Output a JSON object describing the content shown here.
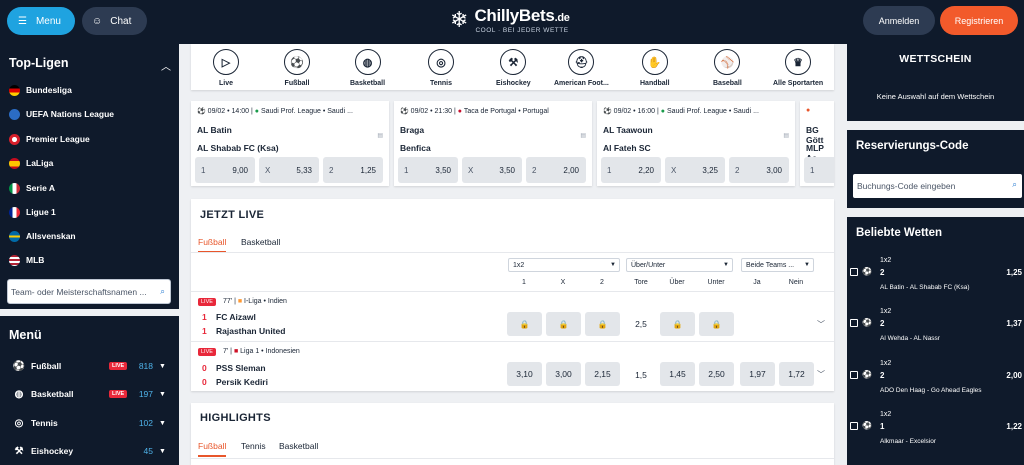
{
  "header": {
    "menu_label": "Menu",
    "chat_label": "Chat",
    "logo_main": "ChillyBets",
    "logo_suffix": ".de",
    "tagline": "COOL · BEI JEDER WETTE",
    "login": "Anmelden",
    "register": "Registrieren"
  },
  "sidebar": {
    "leagues_title": "Top-Ligen",
    "leagues": [
      {
        "name": "Bundesliga",
        "color": "#f3c000"
      },
      {
        "name": "UEFA Nations League",
        "color": "#2b6cc4"
      },
      {
        "name": "Premier League",
        "color": "#d71f2b"
      },
      {
        "name": "LaLiga",
        "color": "#e7a900"
      },
      {
        "name": "Serie A",
        "color": "#1a9b4b"
      },
      {
        "name": "Ligue 1",
        "color": "#1f3c99"
      },
      {
        "name": "Allsvenskan",
        "color": "#2b6cc4"
      },
      {
        "name": "MLB",
        "color": "#cf2233"
      }
    ],
    "search_placeholder": "Team- oder Meisterschaftsnamen ...",
    "menu_title": "Menü",
    "menu_items": [
      {
        "label": "Fußball",
        "live": "LIVE",
        "count": "818"
      },
      {
        "label": "Basketball",
        "live": "LIVE",
        "count": "197"
      },
      {
        "label": "Tennis",
        "live": "",
        "count": "102"
      },
      {
        "label": "Eishockey",
        "live": "",
        "count": "45"
      }
    ]
  },
  "sports": [
    "Live",
    "Fußball",
    "Basketball",
    "Tennis",
    "Eishockey",
    "American Foot...",
    "Handball",
    "Baseball",
    "Alle Sportarten"
  ],
  "events": [
    {
      "date": "09/02 • 14:00",
      "league": "Saudi Prof. League • Saudi ...",
      "home": "AL Batin",
      "away": "AL Shabab FC (Ksa)",
      "odds": [
        "9,00",
        "5,33",
        "1,25"
      ]
    },
    {
      "date": "09/02 • 21:30",
      "league": "Taca de Portugal • Portugal",
      "home": "Braga",
      "away": "Benfica",
      "odds": [
        "3,50",
        "3,50",
        "2,00"
      ]
    },
    {
      "date": "09/02 • 16:00",
      "league": "Saudi Prof. League • Saudi ...",
      "home": "AL Taawoun",
      "away": "Al Fateh SC",
      "odds": [
        "2,20",
        "3,25",
        "3,00"
      ]
    },
    {
      "date": "",
      "league": "",
      "home": "BG Gött",
      "away": "MLP Ac",
      "odds": [
        "1"
      ]
    }
  ],
  "odd_keys": [
    "1",
    "X",
    "2"
  ],
  "live": {
    "title": "JETZT LIVE",
    "tabs": [
      "Fußball",
      "Basketball"
    ],
    "selects": [
      "1x2",
      "Über/Unter",
      "Beide Teams ..."
    ],
    "cols": [
      "1",
      "X",
      "2",
      "Tore",
      "Über",
      "Unter",
      "Ja",
      "Nein"
    ],
    "live_badge": "LIVE",
    "matches": [
      {
        "minute": "77'",
        "league": "I-Liga • Indien",
        "home": "FC Aizawl",
        "away": "Rajasthan United",
        "hs": "1",
        "as": "1",
        "tore": "2,5",
        "odds": []
      },
      {
        "minute": "7'",
        "league": "Liga 1 • Indonesien",
        "home": "PSS Sleman",
        "away": "Persik Kediri",
        "hs": "0",
        "as": "0",
        "tore": "1,5",
        "odds": [
          "3,10",
          "3,00",
          "2,15",
          "1,45",
          "2,50",
          "1,97",
          "1,72"
        ]
      }
    ]
  },
  "highlights": {
    "title": "HIGHLIGHTS",
    "tabs": [
      "Fußball",
      "Tennis",
      "Basketball"
    ]
  },
  "betslip": {
    "title": "WETTSCHEIN",
    "empty": "Keine Auswahl auf dem Wettschein"
  },
  "reservation": {
    "title": "Reservierungs-Code",
    "placeholder": "Buchungs-Code eingeben"
  },
  "popular": {
    "title": "Beliebte Wetten",
    "bets": [
      {
        "market": "1x2",
        "selection": "2",
        "odd": "1,25",
        "match": "AL Batin - AL Shabab FC (Ksa)"
      },
      {
        "market": "1x2",
        "selection": "2",
        "odd": "1,37",
        "match": "Al Wehda - AL Nassr"
      },
      {
        "market": "1x2",
        "selection": "2",
        "odd": "2,00",
        "match": "ADO Den Haag - Go Ahead Eagles"
      },
      {
        "market": "1x2",
        "selection": "1",
        "odd": "1,22",
        "match": "Alkmaar - Excelsior"
      }
    ]
  }
}
